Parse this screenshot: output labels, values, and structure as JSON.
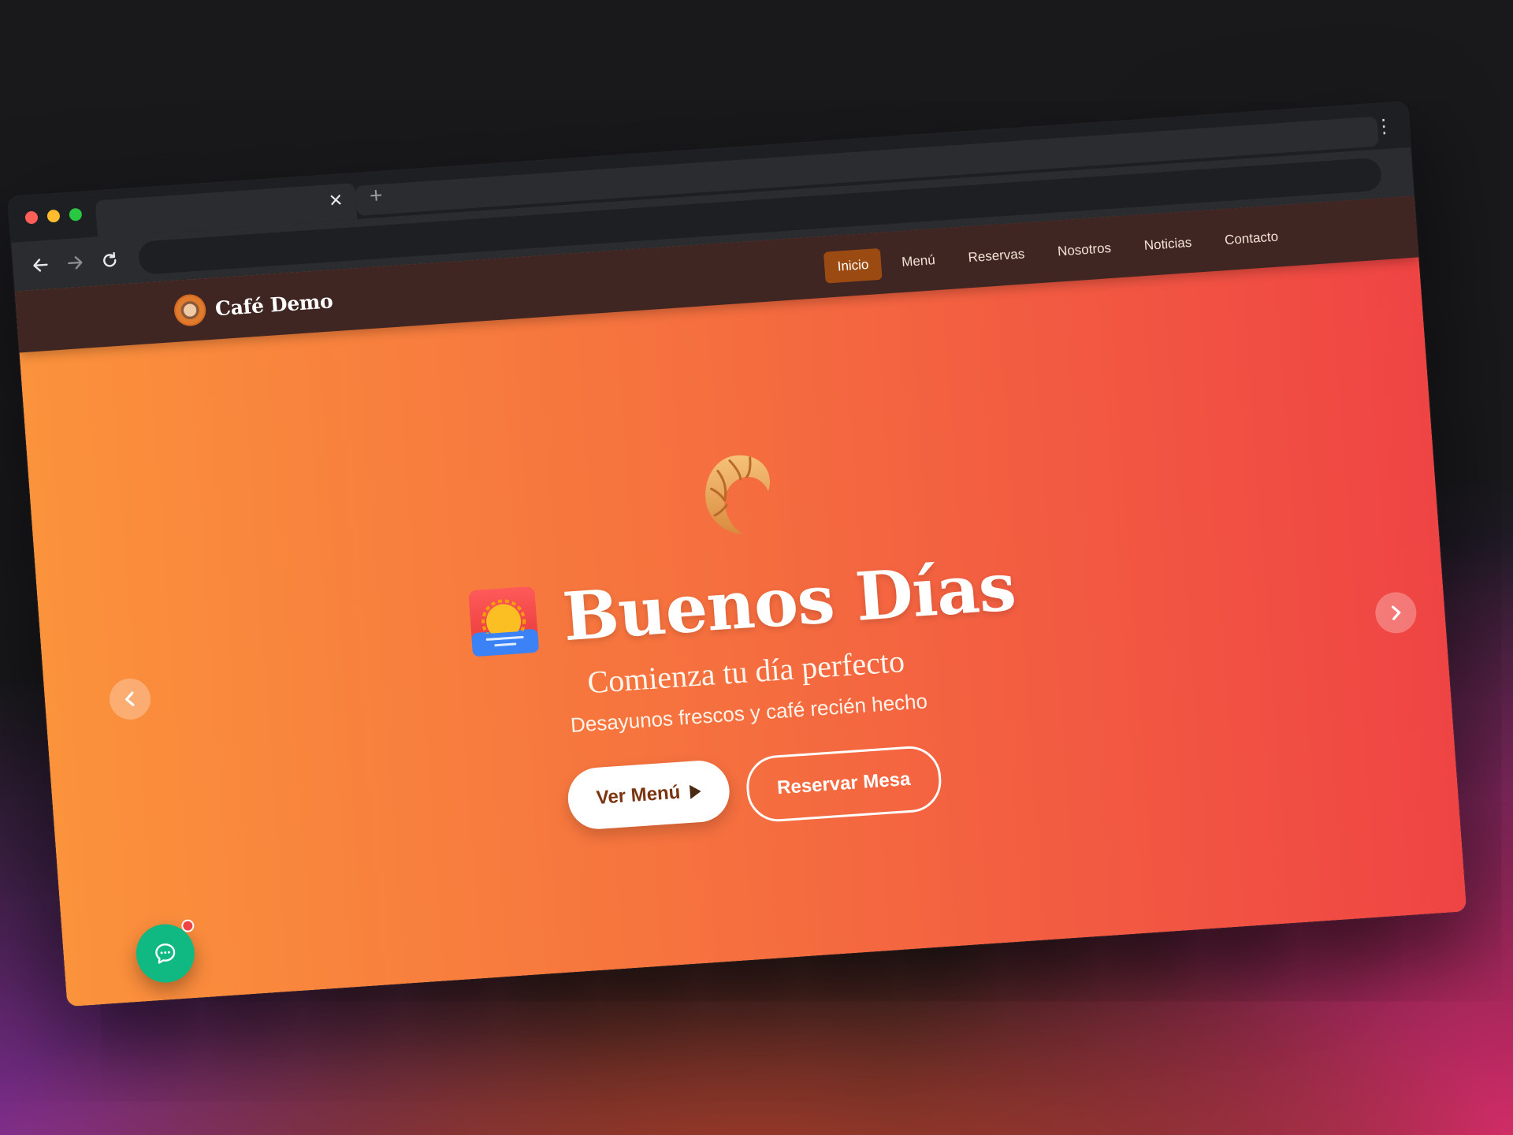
{
  "browser": {
    "tab_close_glyph": "✕",
    "tab_new_glyph": "+",
    "menu_glyph": "⋮"
  },
  "site": {
    "brand_name": "Café Demo",
    "nav": [
      {
        "label": "Inicio",
        "active": true
      },
      {
        "label": "Menú",
        "active": false
      },
      {
        "label": "Reservas",
        "active": false
      },
      {
        "label": "Nosotros",
        "active": false
      },
      {
        "label": "Noticias",
        "active": false
      },
      {
        "label": "Contacto",
        "active": false
      }
    ]
  },
  "hero": {
    "title": "Buenos Días",
    "subtitle": "Comienza tu día perfecto",
    "tagline": "Desayunos frescos y café recién hecho",
    "primary_cta": "Ver Menú",
    "secondary_cta": "Reservar Mesa",
    "gradient_start": "#fb923c",
    "gradient_end": "#ef4444"
  },
  "colors": {
    "nav_background": "#3f2622",
    "active_nav": "#9b4a12",
    "chat_button": "#10b981",
    "notification_dot": "#ef4444"
  },
  "icons": [
    "croissant-icon",
    "sunrise-icon",
    "coffee-logo-icon",
    "chat-icon",
    "chevron-left-icon",
    "chevron-right-icon",
    "play-icon"
  ]
}
